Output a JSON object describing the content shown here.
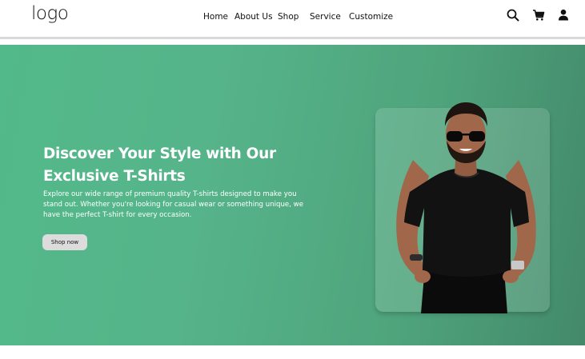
{
  "header": {
    "logo": "logo",
    "nav": [
      {
        "label": "Home"
      },
      {
        "label": "About Us"
      },
      {
        "label": "Shop"
      },
      {
        "label": "Service"
      },
      {
        "label": "Customize"
      }
    ],
    "icons": [
      "search-icon",
      "cart-icon",
      "user-icon"
    ]
  },
  "hero": {
    "title": "Discover Your Style with Our Exclusive T-Shirts",
    "description": "Explore our wide range of premium quality T-shirts designed to make you stand out. Whether you're looking for casual wear or something unique, we have the perfect T-shirt for every occasion.",
    "cta_label": "Shop now"
  },
  "colors": {
    "hero_gradient_start": "#52b98a",
    "hero_gradient_end": "#43896a",
    "button_bg": "#dcdcdc",
    "text_light": "#ffffff"
  }
}
